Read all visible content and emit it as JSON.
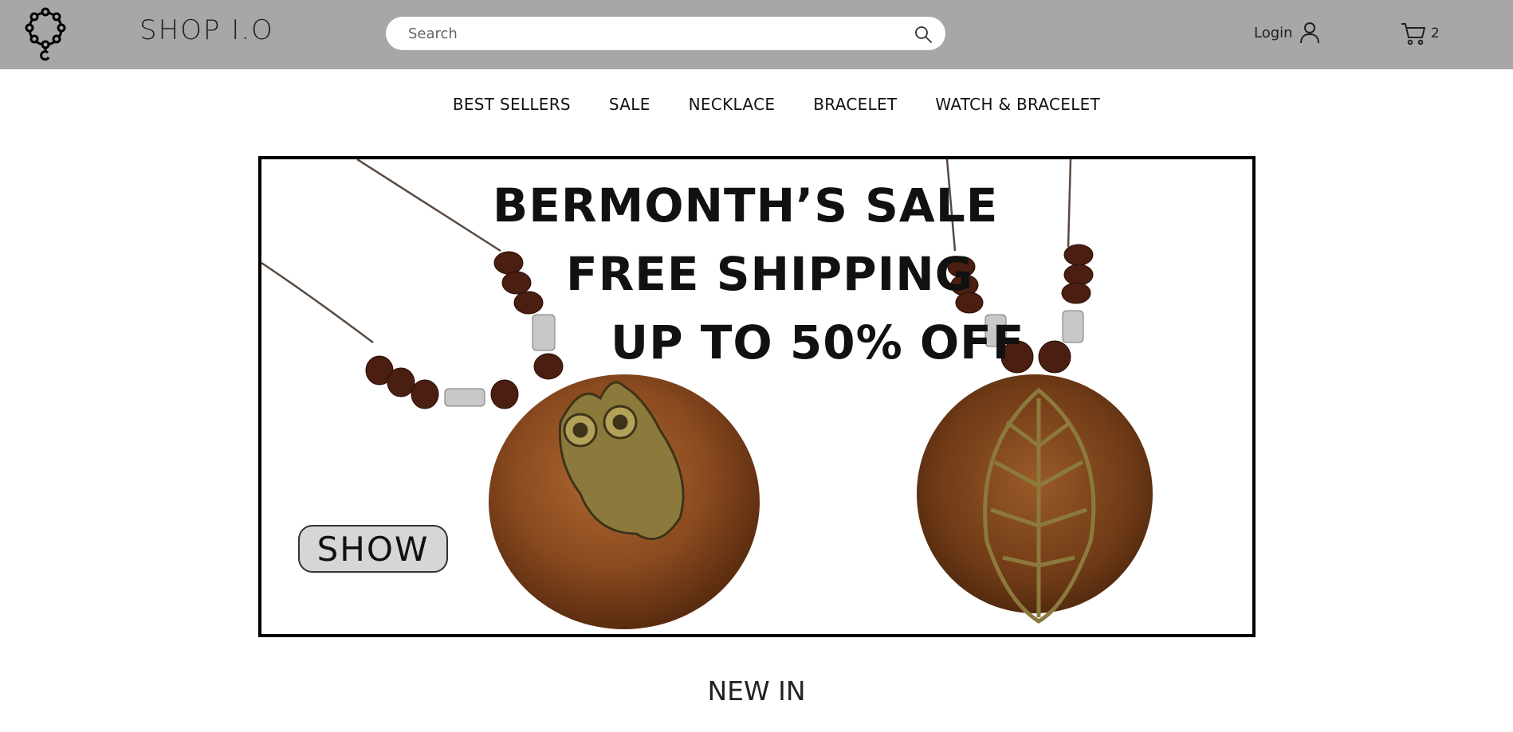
{
  "header": {
    "brand": "SHOP I.O",
    "search_placeholder": "Search",
    "login_label": "Login",
    "cart_count": "2",
    "logo_icon": "bead-bracelet-logo-icon",
    "search_icon": "search-icon",
    "user_icon": "user-icon",
    "cart_icon": "cart-icon",
    "header_color": "#a8a6a8"
  },
  "nav": {
    "items": [
      "BEST SELLERS",
      "SALE",
      "NECKLACE",
      "BRACELET",
      "WATCH & BRACELET"
    ]
  },
  "banner": {
    "line1": "BERMONTH’S SALE",
    "line2": "FREE SHIPPING",
    "line3": "UP TO 50% OFF",
    "button_label": "SHOW"
  },
  "section": {
    "title": "NEW IN"
  }
}
